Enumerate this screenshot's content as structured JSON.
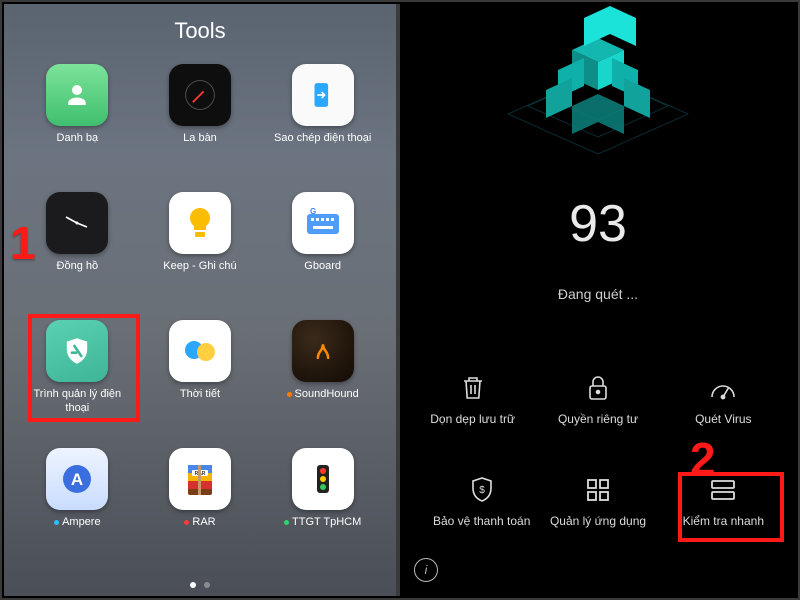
{
  "left": {
    "title": "Tools",
    "apps": [
      {
        "label": "Danh bạ"
      },
      {
        "label": "La bàn"
      },
      {
        "label": "Sao chép điện thoại"
      },
      {
        "label": "Đồng hồ"
      },
      {
        "label": "Keep - Ghi chú"
      },
      {
        "label": "Gboard"
      },
      {
        "label": "Trình quản lý điện thoại"
      },
      {
        "label": "Thời tiết"
      },
      {
        "label": "SoundHound",
        "dot": "#ff7b00"
      },
      {
        "label": "Ampere",
        "dot": "#22c3ff"
      },
      {
        "label": "RAR",
        "dot": "#ff3a3a"
      },
      {
        "label": "TTGT TpHCM",
        "dot": "#2bd66a"
      }
    ],
    "step_number": "1"
  },
  "right": {
    "score": "93",
    "status": "Đang quét ...",
    "actions_row1": [
      {
        "label": "Dọn dẹp lưu trữ",
        "icon": "trash"
      },
      {
        "label": "Quyền riêng tư",
        "icon": "lock"
      },
      {
        "label": "Quét Virus",
        "icon": "speed"
      }
    ],
    "actions_row2": [
      {
        "label": "Bảo vệ thanh toán",
        "icon": "shield"
      },
      {
        "label": "Quản lý ứng dụng",
        "icon": "grid"
      },
      {
        "label": "Kiểm tra nhanh",
        "icon": "stack"
      }
    ],
    "step_number": "2",
    "info": "i"
  }
}
